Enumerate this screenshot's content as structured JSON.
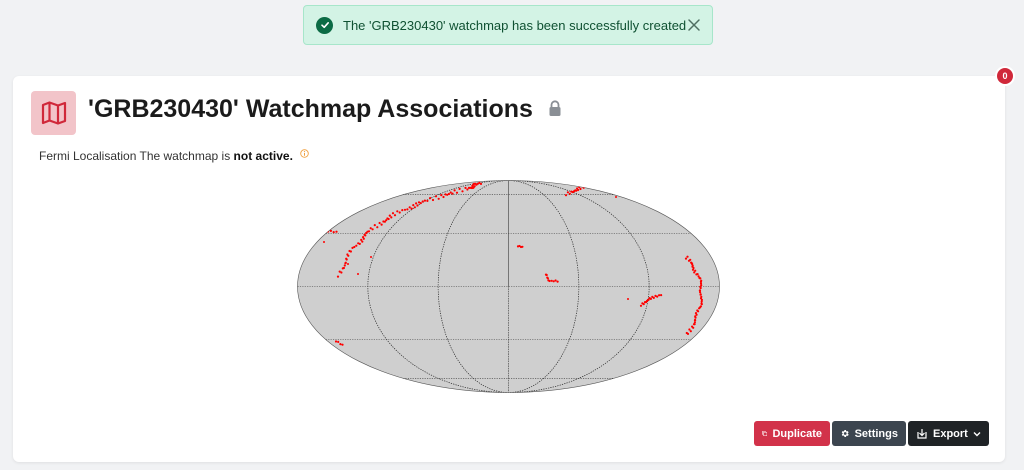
{
  "toast": {
    "message": "The 'GRB230430' watchmap has been successfully created",
    "icon": "check-circle-icon",
    "close_icon": "close-icon",
    "color": "#0f5132",
    "background": "#d3f3e5"
  },
  "notification_badge": {
    "count": "0",
    "color": "#d0283a"
  },
  "header": {
    "title": "'GRB230430' Watchmap Associations",
    "icon": "map-icon",
    "lock_icon": "lock-icon"
  },
  "subtitle": {
    "prefix": "Fermi Localisation The watchmap is",
    "status": "not active.",
    "info_icon": "info-icon"
  },
  "skymap": {
    "projection": "aitoff",
    "background_color": "#cfcfcf",
    "point_color": "#ff0000"
  },
  "actions": {
    "duplicate_label": "Duplicate",
    "settings_label": "Settings",
    "export_label": "Export",
    "duplicate_color": "#d2324a"
  }
}
